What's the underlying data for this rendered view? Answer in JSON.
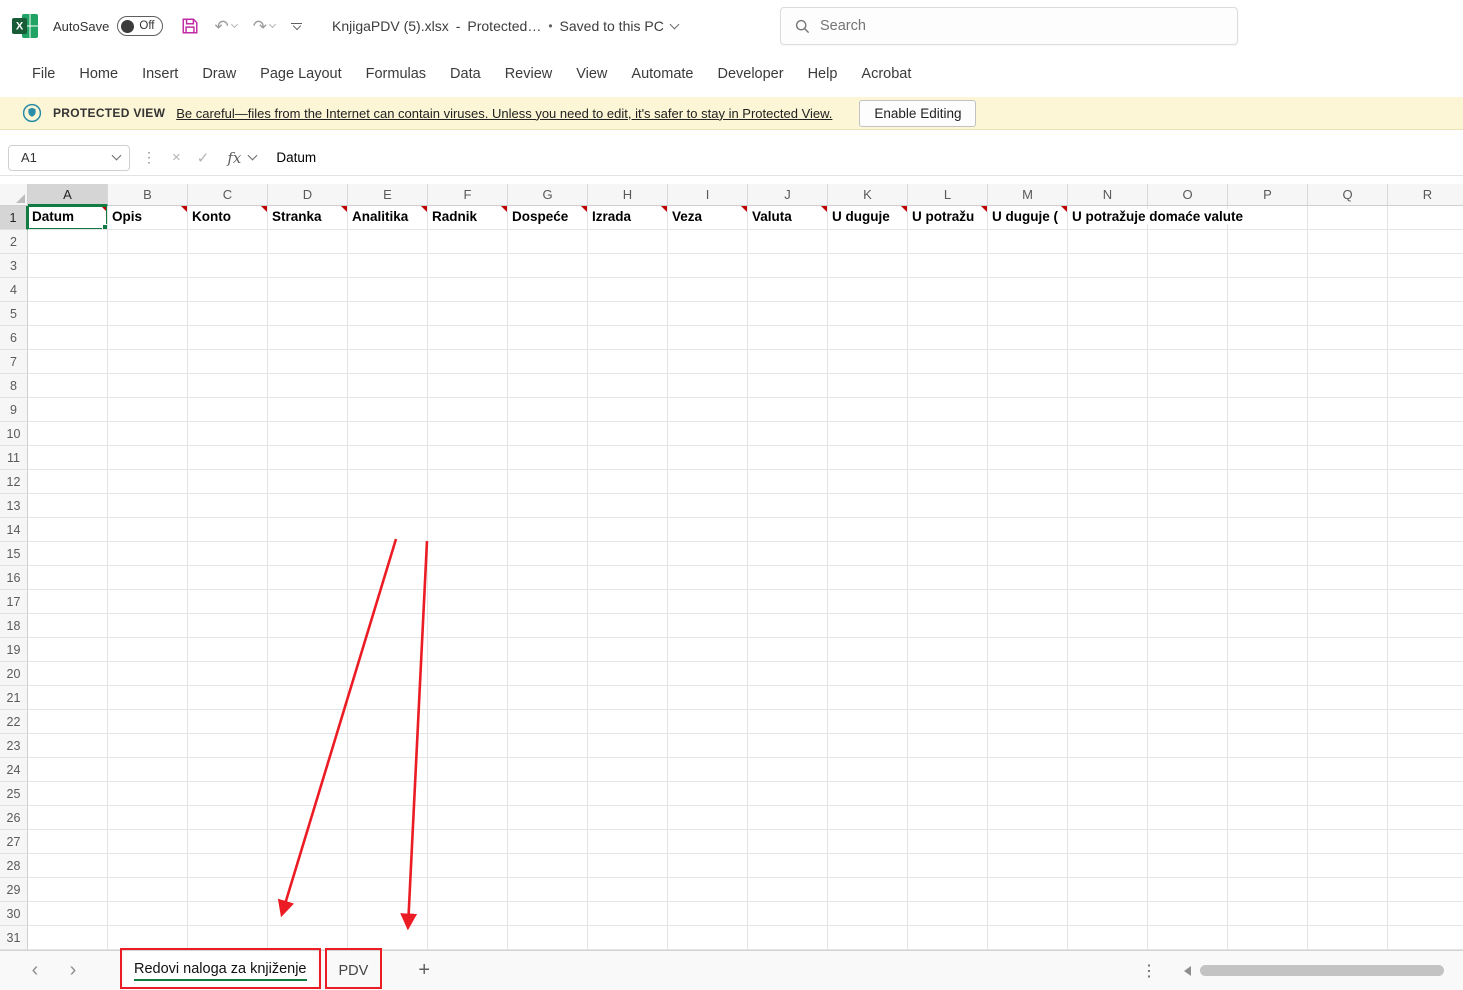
{
  "titlebar": {
    "autosave_label": "AutoSave",
    "autosave_state": "Off",
    "filename": "KnjigaPDV (5).xlsx",
    "separator": "-",
    "protected_status": "Protected…",
    "bullet": "•",
    "saved_status": "Saved to this PC",
    "search_placeholder": "Search"
  },
  "menu": {
    "tabs": [
      "File",
      "Home",
      "Insert",
      "Draw",
      "Page Layout",
      "Formulas",
      "Data",
      "Review",
      "View",
      "Automate",
      "Developer",
      "Help",
      "Acrobat"
    ]
  },
  "protected_view": {
    "label": "PROTECTED VIEW",
    "message": "Be careful—files from the Internet can contain viruses. Unless you need to edit, it's safer to stay in Protected View.",
    "button_label": "Enable Editing"
  },
  "formula_bar": {
    "name_box": "A1",
    "fx_label": "fx",
    "value": "Datum"
  },
  "grid": {
    "columns": [
      "A",
      "B",
      "C",
      "D",
      "E",
      "F",
      "G",
      "H",
      "I",
      "J",
      "K",
      "L",
      "M",
      "N",
      "O",
      "P",
      "Q",
      "R"
    ],
    "row_count": 31,
    "selected_cell": "A1",
    "selected_column": "A",
    "selected_row": 1,
    "header_cells": [
      {
        "col": "A",
        "text": "Datum",
        "comment": true
      },
      {
        "col": "B",
        "text": "Opis",
        "comment": true
      },
      {
        "col": "C",
        "text": "Konto",
        "comment": true
      },
      {
        "col": "D",
        "text": "Stranka",
        "comment": true
      },
      {
        "col": "E",
        "text": "Analitika",
        "comment": true
      },
      {
        "col": "F",
        "text": "Radnik",
        "comment": true
      },
      {
        "col": "G",
        "text": "Dospeće",
        "comment": true
      },
      {
        "col": "H",
        "text": "Izrada",
        "comment": true
      },
      {
        "col": "I",
        "text": "Veza",
        "comment": true
      },
      {
        "col": "J",
        "text": "Valuta",
        "comment": true
      },
      {
        "col": "K",
        "text": "U duguje",
        "comment": true
      },
      {
        "col": "L",
        "text": "U potražu",
        "comment": true
      },
      {
        "col": "M",
        "text": "U duguje (",
        "comment": true
      },
      {
        "col": "N",
        "text": "U potražuje domaće valute",
        "comment": false,
        "overflow": true
      }
    ]
  },
  "sheet_tabs": {
    "tabs": [
      {
        "label": "Redovi naloga za knjiženje",
        "active": true
      },
      {
        "label": "PDV",
        "active": false
      }
    ],
    "add_sheet": "+"
  },
  "colors": {
    "accent_green": "#107C41",
    "annotation_red": "#EC1C24",
    "banner_bg": "#FCF6D6",
    "comment_red": "#C00000"
  }
}
